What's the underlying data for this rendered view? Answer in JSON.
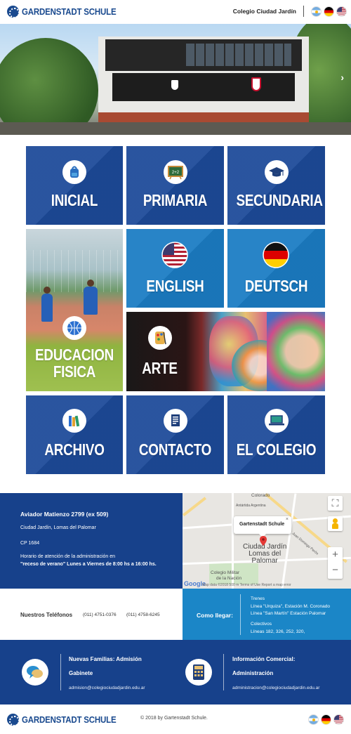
{
  "header": {
    "logo_text": "GARDENSTADT SCHULE",
    "college_link": "Colegio Ciudad Jardín",
    "languages": [
      "es",
      "de",
      "en"
    ]
  },
  "hero": {
    "next_arrow": "›",
    "slides": 3,
    "active_slide": 1
  },
  "tiles": {
    "inicial": {
      "label": "INICIAL",
      "icon": "backpack-icon"
    },
    "primaria": {
      "label": "PRIMARIA",
      "icon": "chalkboard-icon"
    },
    "secundaria": {
      "label": "SECUNDARIA",
      "icon": "graduation-cap-icon"
    },
    "english": {
      "label": "ENGLISH",
      "icon": "us-flag-icon"
    },
    "deutsch": {
      "label": "DEUTSCH",
      "icon": "german-flag-icon"
    },
    "edfisica": {
      "label1": "EDUCACION",
      "label2": "FISICA",
      "icon": "basketball-icon"
    },
    "arte": {
      "label": "ARTE",
      "icon": "palette-icon"
    },
    "archivo": {
      "label": "ARCHIVO",
      "icon": "books-icon"
    },
    "contacto": {
      "label": "CONTACTO",
      "icon": "document-icon"
    },
    "colegio": {
      "label": "EL COLEGIO",
      "icon": "laptop-icon"
    }
  },
  "chalkboard_text": "2+2",
  "info": {
    "address": "Aviador Matienzo 2799 (ex 509)",
    "city": "Ciudad Jardín, Lomas del Palomar",
    "cp": "CP 1684",
    "hours_intro": "Horario de atención de la administración en",
    "hours_bold": "\"receso de verano\" Lunes a Viernes de 8:00 hs a 16:00 hs."
  },
  "map": {
    "card_title": "Gartenstadt Schule",
    "close": "×",
    "place_line1": "Ciudad Jardín",
    "place_line2": "Lomas del",
    "place_line3": "Palomar",
    "label_colorado": "Colorado",
    "label_antartida": "Antártida Argentina",
    "label_gdor": "Gdor. Juan Domingo Perón",
    "label_colegio1": "Colegio Militar",
    "label_colegio2": "de la Nación",
    "google": "Google",
    "footer_text": "Map data ©2018   500 m   Terms of Use   Report a map error",
    "zoom_in": "+",
    "zoom_out": "−",
    "fullscreen": "⛶"
  },
  "phones": {
    "label": "Nuestros Teléfonos",
    "phone1": "(011) 4751-0376",
    "phone2": "(011) 4758-6245"
  },
  "transport": {
    "label": "Como llegar:",
    "lines": [
      "Trenes",
      "Línea \"Urquiza\", Estación M. Coronado",
      "Línea \"San Martín\" Estación Palomar",
      "Colectivos",
      "Líneas 182, 326, 252, 320,"
    ]
  },
  "contact": {
    "families_title1": "Nuevas Familias: Admisión",
    "families_title2": "Gabinete",
    "families_mail": "admision@colegiociudadjardin.edu.ar",
    "commercial_title1": "Información Comercial:",
    "commercial_title2": "Administración",
    "commercial_mail": "administracion@colegiociudadjardin.edu.ar"
  },
  "footer": {
    "logo_text": "GARDENSTADT SCHULE",
    "copyright": "© 2018 by Gartenstadt Schule."
  },
  "colors": {
    "dark_blue": "#1d4a99",
    "light_blue": "#1b7cc4",
    "band_blue": "#17418b"
  }
}
